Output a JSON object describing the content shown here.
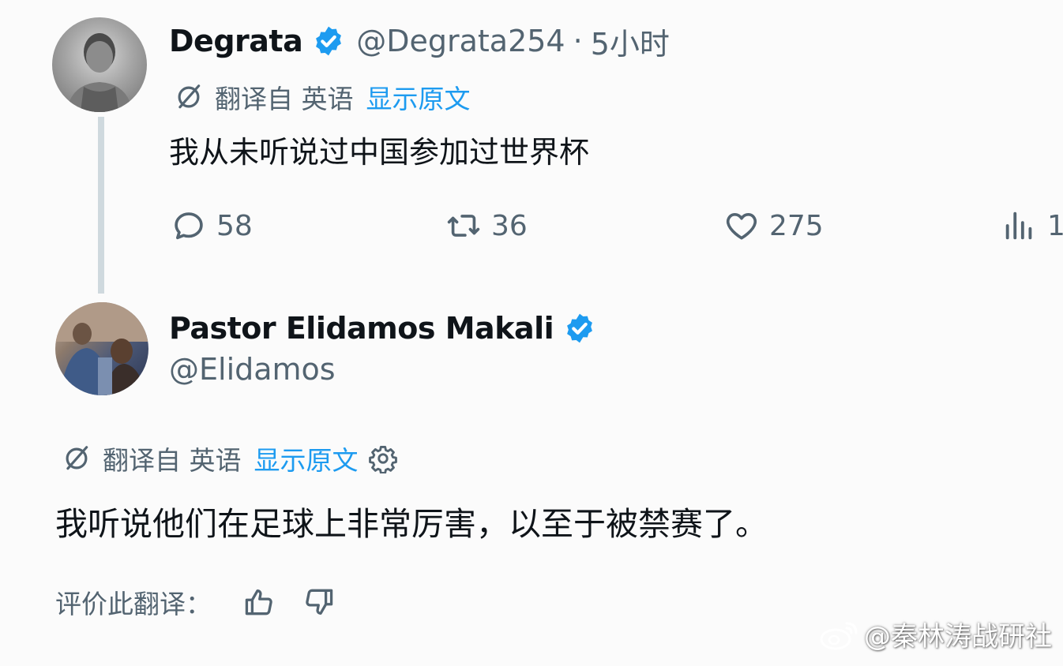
{
  "colors": {
    "text": "#0f1419",
    "secondary": "#536471",
    "link": "#1d9bf0",
    "verified": "#1d9bf0"
  },
  "tweet1": {
    "display_name": "Degrata",
    "handle": "@Degrata254",
    "separator": "·",
    "time": "5小时",
    "translation": {
      "label": "翻译自 英语",
      "show_original": "显示原文"
    },
    "text": "我从未听说过中国参加过世界杯",
    "actions": {
      "replies": "58",
      "retweets": "36",
      "likes": "275",
      "views": "1"
    }
  },
  "tweet2": {
    "display_name": "Pastor Elidamos Makali",
    "handle": "@Elidamos",
    "translation": {
      "label": "翻译自 英语",
      "show_original": "显示原文"
    },
    "text": "我听说他们在足球上非常厉害，以至于被禁赛了。",
    "rate_label": "评价此翻译："
  },
  "icons": {
    "verified": "verified-badge-icon",
    "translate": "translate-icon",
    "settings": "gear-icon",
    "reply": "reply-icon",
    "retweet": "retweet-icon",
    "like": "heart-icon",
    "views": "views-icon",
    "thumbs_up": "thumbs-up-icon",
    "thumbs_down": "thumbs-down-icon",
    "weibo": "weibo-icon"
  },
  "watermark": {
    "text": "@秦林涛战研社"
  }
}
